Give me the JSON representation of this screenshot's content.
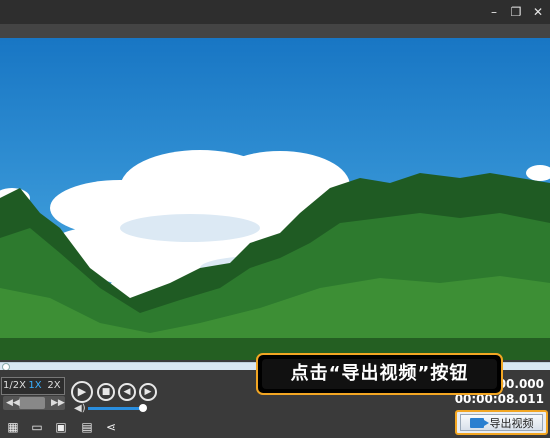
{
  "window": {
    "minimize_icon": "minimize-icon",
    "maximize_icon": "maximize-icon",
    "close_icon": "close-icon",
    "minimize_glyph": "–",
    "maximize_glyph": "❐",
    "close_glyph": "✕"
  },
  "player": {
    "progress": 0.0,
    "speed_options": [
      "1/2X",
      "1X",
      "2X"
    ],
    "speed_selected": "1X",
    "current_time": "00:00:00.000",
    "current_time_display": "00.000",
    "total_time": "00:00:08.011",
    "total_time_display": "00:00:08.011",
    "volume": 1.0
  },
  "callout": {
    "text": "点击“导出视频”按钮"
  },
  "toolbar": {
    "icons": [
      "new-icon",
      "open-folder-icon",
      "save-icon",
      "save-as-icon",
      "share-icon"
    ],
    "export_label": "导出视频"
  },
  "colors": {
    "accent": "#f2a623",
    "highlight": "#3ab0ff",
    "sky": "#2a86cf"
  }
}
